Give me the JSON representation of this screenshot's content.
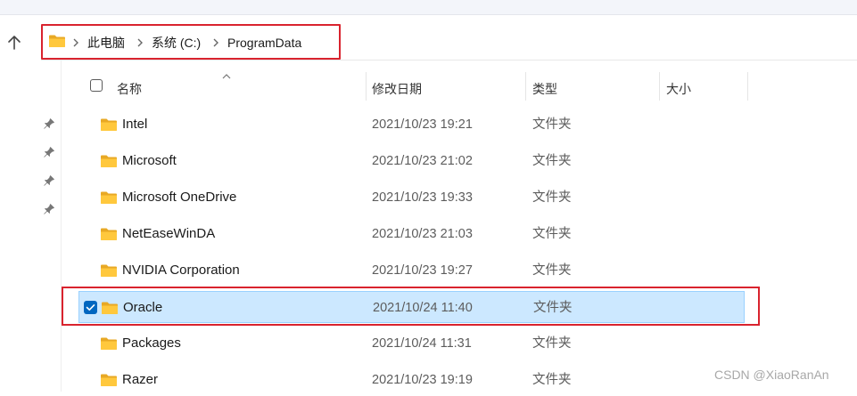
{
  "breadcrumb": [
    "此电脑",
    "系统 (C:)",
    "ProgramData"
  ],
  "columns": {
    "name": "名称",
    "date": "修改日期",
    "type": "类型",
    "size": "大小"
  },
  "files": [
    {
      "name": "Intel",
      "date": "2021/10/23 19:21",
      "type": "文件夹"
    },
    {
      "name": "Microsoft",
      "date": "2021/10/23 21:02",
      "type": "文件夹"
    },
    {
      "name": "Microsoft OneDrive",
      "date": "2021/10/23 19:33",
      "type": "文件夹"
    },
    {
      "name": "NetEaseWinDA",
      "date": "2021/10/23 21:03",
      "type": "文件夹"
    },
    {
      "name": "NVIDIA Corporation",
      "date": "2021/10/23 19:27",
      "type": "文件夹"
    },
    {
      "name": "Oracle",
      "date": "2021/10/24 11:40",
      "type": "文件夹"
    },
    {
      "name": "Packages",
      "date": "2021/10/24 11:31",
      "type": "文件夹"
    },
    {
      "name": "Razer",
      "date": "2021/10/23 19:19",
      "type": "文件夹"
    }
  ],
  "selected_row": "Oracle",
  "watermark": "CSDN @XiaoRanAn",
  "colors": {
    "accent": "#0067c0",
    "selection": "#cce8ff",
    "highlight_box": "#d9232e",
    "folder": "#ffc83d"
  }
}
